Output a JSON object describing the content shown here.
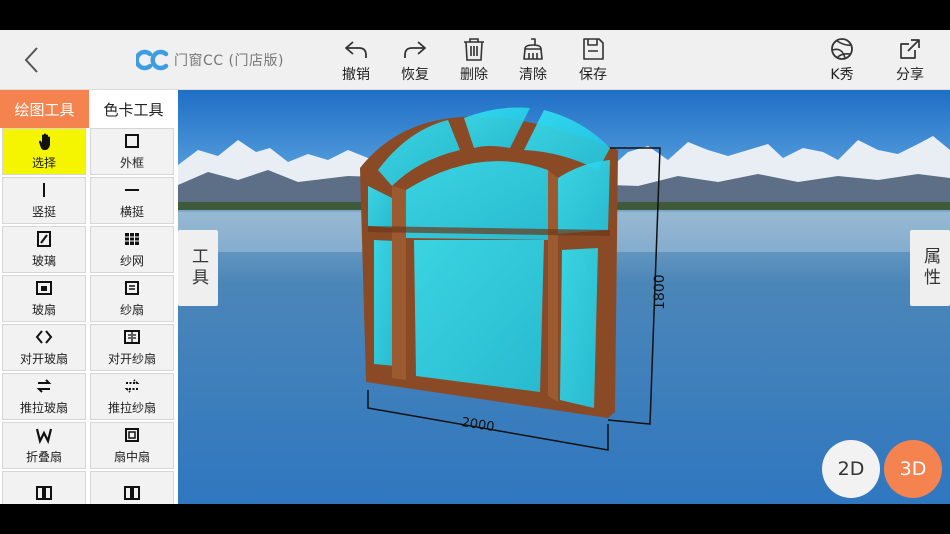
{
  "app": {
    "logo_text": "门窗CC (门店版)",
    "accent_color": "#f4834f",
    "selected_color": "#f6f500"
  },
  "toolbar": {
    "back_icon": "chevron-left-icon",
    "undo_label": "撤销",
    "redo_label": "恢复",
    "delete_label": "删除",
    "clear_label": "清除",
    "save_label": "保存",
    "kshow_label": "K秀",
    "share_label": "分享"
  },
  "panel": {
    "tabs": [
      {
        "label": "绘图工具",
        "active": true
      },
      {
        "label": "色卡工具",
        "active": false
      }
    ],
    "tools": [
      {
        "label": "选择",
        "icon": "hand-icon",
        "selected": true
      },
      {
        "label": "外框",
        "icon": "frame-icon",
        "selected": false
      },
      {
        "label": "竖挺",
        "icon": "vertical-mullion-icon",
        "selected": false
      },
      {
        "label": "横挺",
        "icon": "horizontal-mullion-icon",
        "selected": false
      },
      {
        "label": "玻璃",
        "icon": "glass-icon",
        "selected": false
      },
      {
        "label": "纱网",
        "icon": "screen-mesh-icon",
        "selected": false
      },
      {
        "label": "玻扇",
        "icon": "glass-sash-icon",
        "selected": false
      },
      {
        "label": "纱扇",
        "icon": "screen-sash-icon",
        "selected": false
      },
      {
        "label": "对开玻扇",
        "icon": "double-glass-sash-icon",
        "selected": false
      },
      {
        "label": "对开纱扇",
        "icon": "double-screen-sash-icon",
        "selected": false
      },
      {
        "label": "推拉玻扇",
        "icon": "sliding-glass-sash-icon",
        "selected": false
      },
      {
        "label": "推拉纱扇",
        "icon": "sliding-screen-sash-icon",
        "selected": false
      },
      {
        "label": "折叠扇",
        "icon": "folding-sash-icon",
        "selected": false
      },
      {
        "label": "扇中扇",
        "icon": "sash-in-sash-icon",
        "selected": false
      },
      {
        "label": "",
        "icon": "split-panel-icon",
        "selected": false
      },
      {
        "label": "",
        "icon": "split-panel-icon",
        "selected": false
      }
    ]
  },
  "canvas": {
    "left_tab_label": "工具",
    "right_tab_label": "属性",
    "width_dimension": "2000",
    "height_dimension": "1800",
    "mode_2d_label": "2D",
    "mode_3d_label": "3D",
    "frame_color": "#8a4a26",
    "glass_color": "#2ad2e8"
  }
}
